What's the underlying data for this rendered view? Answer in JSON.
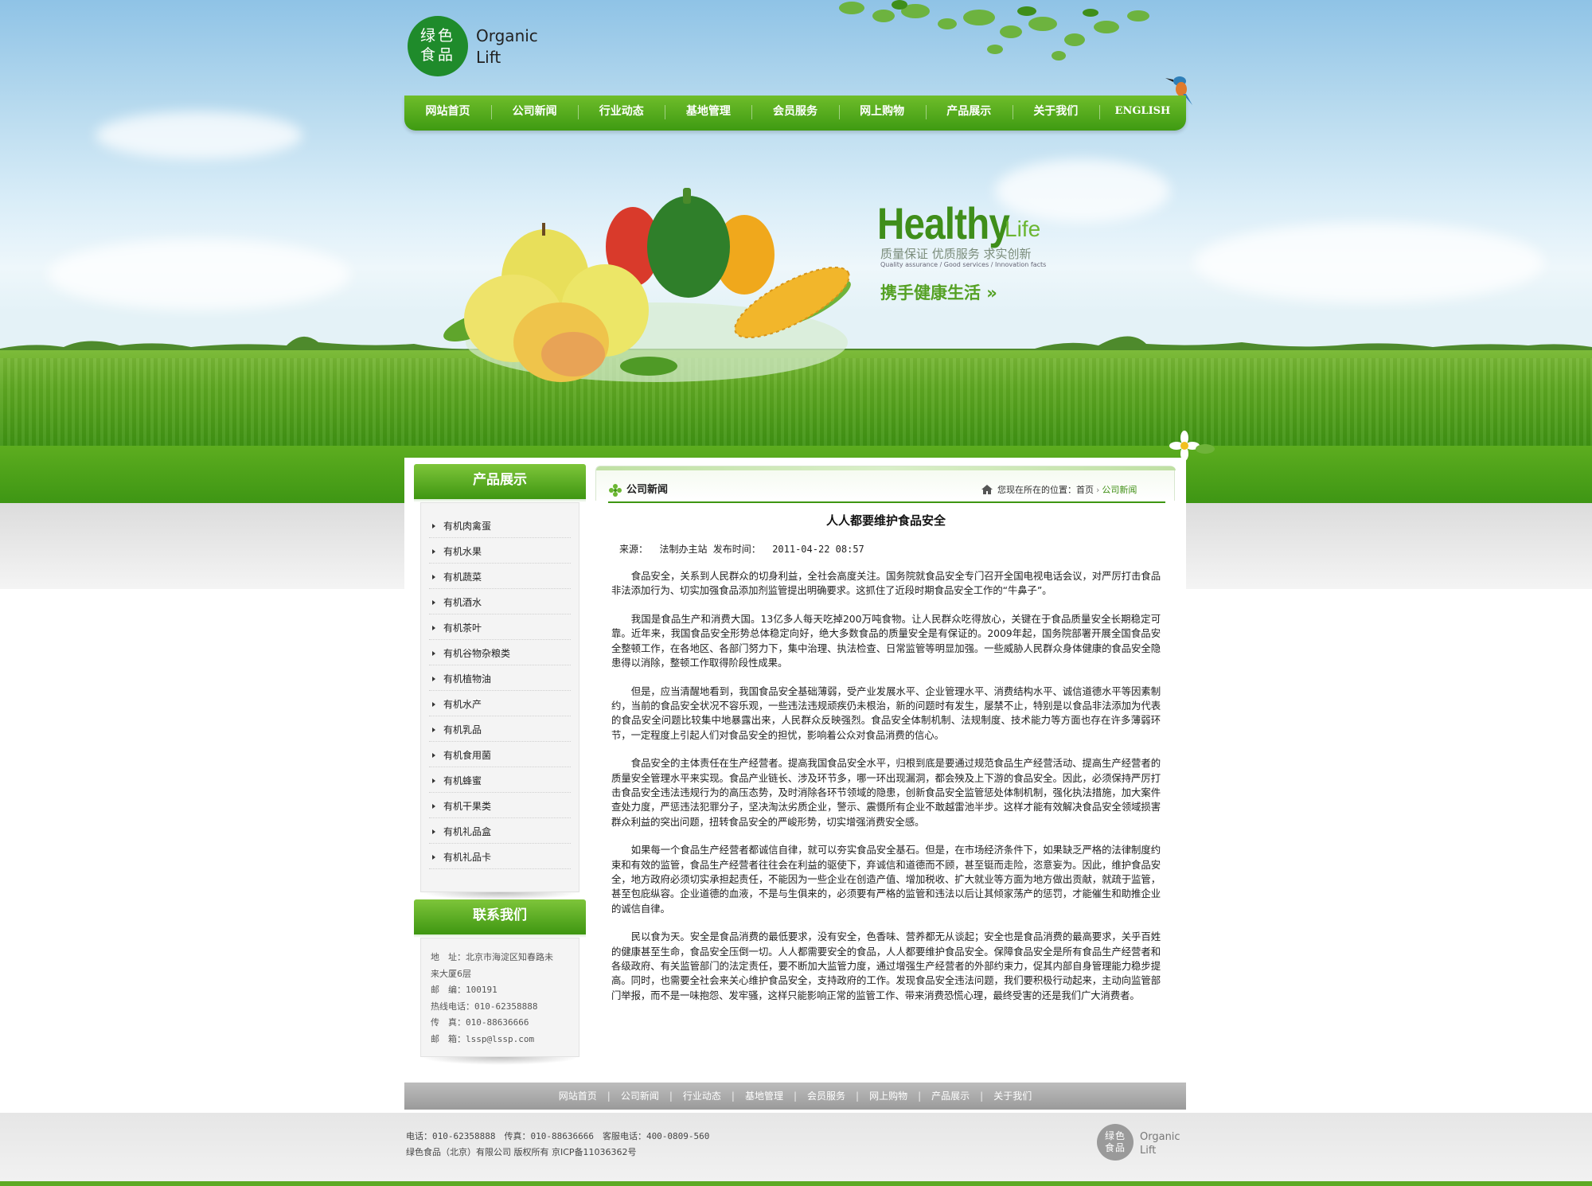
{
  "logo": {
    "seal_line1": "绿色",
    "seal_line2": "食品",
    "text_line1": "Organic",
    "text_line2": "Lift"
  },
  "nav": [
    "网站首页",
    "公司新闻",
    "行业动态",
    "基地管理",
    "会员服务",
    "网上购物",
    "产品展示",
    "关于我们",
    "ENGLISH"
  ],
  "banner": {
    "headline": "Healthy",
    "headline_small": "Life",
    "tagline_cn": "质量保证 优质服务 求实创新",
    "tagline_en": "Quality assurance / Good services / Innovation facts",
    "slogan": "携手健康生活 »"
  },
  "sidebar": {
    "products_title": "产品展示",
    "products": [
      "有机肉禽蛋",
      "有机水果",
      "有机蔬菜",
      "有机酒水",
      "有机茶叶",
      "有机谷物杂粮类",
      "有机植物油",
      "有机水产",
      "有机乳品",
      "有机食用菌",
      "有机蜂蜜",
      "有机干果类",
      "有机礼品盒",
      "有机礼品卡"
    ],
    "contact_title": "联系我们",
    "contact": {
      "address_line1": "地　址：北京市海淀区知春路未",
      "address_line2": "来大厦6层",
      "postcode": "邮　编：100191",
      "hotline": "热线电话：010-62358888",
      "fax": "传　真：010-88636666",
      "email": "邮　箱：lssp@lssp.com"
    }
  },
  "content": {
    "section_title": "公司新闻",
    "breadcrumb_prefix": "您现在所在的位置：",
    "breadcrumb_home": "首页",
    "breadcrumb_current": "公司新闻",
    "article_title": "人人都要维护食品安全",
    "meta_source_label": "来源：",
    "meta_source": "法制办主站",
    "meta_time_label": "发布时间：",
    "meta_time": "2011-04-22 08:57",
    "paragraphs": [
      "食品安全，关系到人民群众的切身利益，全社会高度关注。国务院就食品安全专门召开全国电视电话会议，对严厉打击食品非法添加行为、切实加强食品添加剂监管提出明确要求。这抓住了近段时期食品安全工作的“牛鼻子”。",
      "我国是食品生产和消费大国。13亿多人每天吃掉200万吨食物。让人民群众吃得放心，关键在于食品质量安全长期稳定可靠。近年来，我国食品安全形势总体稳定向好，绝大多数食品的质量安全是有保证的。2009年起，国务院部署开展全国食品安全整顿工作，在各地区、各部门努力下，集中治理、执法检查、日常监管等明显加强。一些威胁人民群众身体健康的食品安全隐患得以消除，整顿工作取得阶段性成果。",
      "但是，应当清醒地看到，我国食品安全基础薄弱，受产业发展水平、企业管理水平、消费结构水平、诚信道德水平等因素制约，当前的食品安全状况不容乐观，一些违法违规顽疾仍未根治，新的问题时有发生，屡禁不止，特别是以食品非法添加为代表的食品安全问题比较集中地暴露出来，人民群众反映强烈。食品安全体制机制、法规制度、技术能力等方面也存在许多薄弱环节，一定程度上引起人们对食品安全的担忧，影响着公众对食品消费的信心。",
      "食品安全的主体责任在生产经营者。提高我国食品安全水平，归根到底是要通过规范食品生产经营活动、提高生产经营者的质量安全管理水平来实现。食品产业链长、涉及环节多，哪一环出现漏洞，都会殃及上下游的食品安全。因此，必须保持严厉打击食品安全违法违规行为的高压态势，及时消除各环节领域的隐患，创新食品安全监管惩处体制机制，强化执法措施，加大案件查处力度，严惩违法犯罪分子，坚决淘汰劣质企业，警示、震慑所有企业不敢越雷池半步。这样才能有效解决食品安全领域损害群众利益的突出问题，扭转食品安全的严峻形势，切实增强消费安全感。",
      "如果每一个食品生产经营者都诚信自律，就可以夯实食品安全基石。但是，在市场经济条件下，如果缺乏严格的法律制度约束和有效的监管，食品生产经营者往往会在利益的驱使下，弃诚信和道德而不顾，甚至铤而走险，恣意妄为。因此，维护食品安全，地方政府必须切实承担起责任，不能因为一些企业在创造产值、增加税收、扩大就业等方面为地方做出贡献，就疏于监管，甚至包庇纵容。企业道德的血液，不是与生俱来的，必须要有严格的监管和违法以后让其倾家荡产的惩罚，才能催生和助推企业的诚信自律。",
      "民以食为天。安全是食品消费的最低要求，没有安全，色香味、营养都无从谈起；安全也是食品消费的最高要求，关乎百姓的健康甚至生命，食品安全压倒一切。人人都需要安全的食品，人人都要维护食品安全。保障食品安全是所有食品生产经营者和各级政府、有关监管部门的法定责任，要不断加大监管力度，通过增强生产经营者的外部约束力，促其内部自身管理能力稳步提高。同时，也需要全社会来关心维护食品安全，支持政府的工作。发现食品安全违法问题，我们要积极行动起来，主动向监管部门举报，而不是一味抱怨、发牢骚，这样只能影响正常的监管工作、带来消费恐慌心理，最终受害的还是我们广大消费者。"
    ]
  },
  "footer": {
    "nav": [
      "网站首页",
      "公司新闻",
      "行业动态",
      "基地管理",
      "会员服务",
      "网上购物",
      "产品展示",
      "关于我们"
    ],
    "info_line1": "电话：010-62358888　传真：010-88636666　客服电话：400-0809-560",
    "info_line2": "绿色食品（北京）有限公司 版权所有 京ICP备11036362号",
    "logo_seal_line1": "绿色",
    "logo_seal_line2": "食品",
    "logo_text_line1": "Organic",
    "logo_text_line2": "Lift"
  },
  "colors": {
    "brand_green": "#3e9611",
    "accent_green": "#6bb631",
    "link_green": "#3f8f14"
  }
}
